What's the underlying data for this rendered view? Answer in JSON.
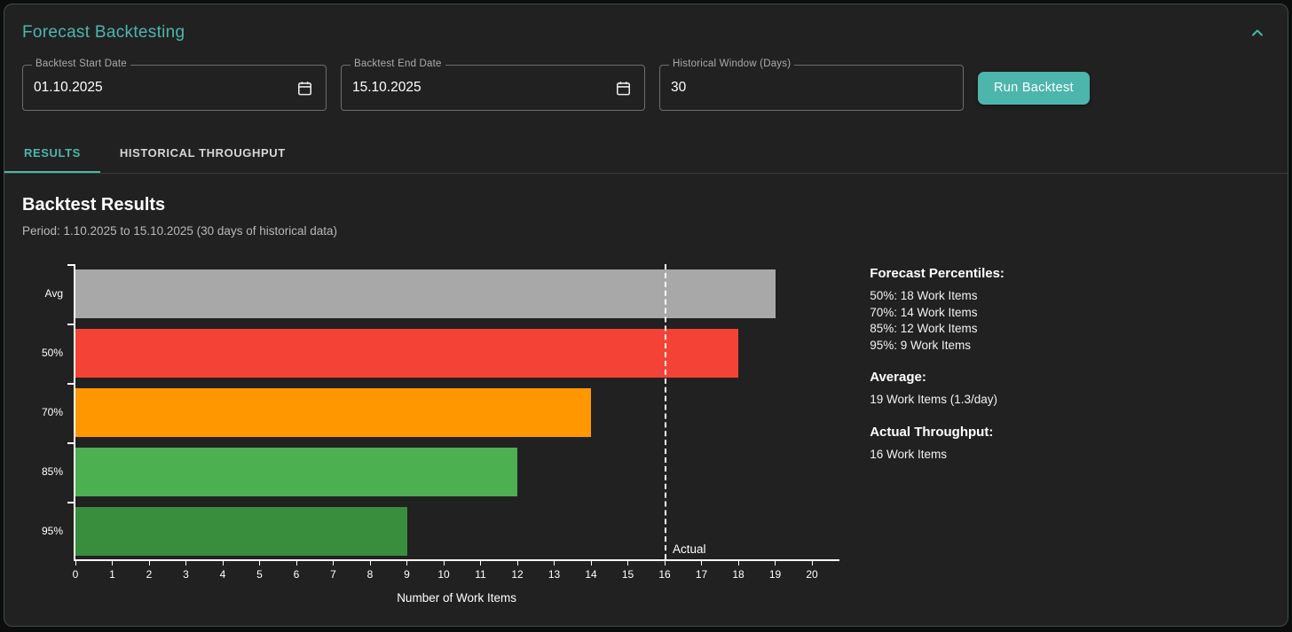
{
  "theme": {
    "accent": "#4db6ac",
    "card_background": "#212121",
    "border": "#3a4f49"
  },
  "header": {
    "title": "Forecast Backtesting"
  },
  "form": {
    "fields": [
      {
        "label": "Backtest Start Date",
        "value": "01.10.2025",
        "icon": "calendar-icon"
      },
      {
        "label": "Backtest End Date",
        "value": "15.10.2025",
        "icon": "calendar-icon"
      },
      {
        "label": "Historical Window (Days)",
        "value": "30"
      }
    ],
    "run_button": "Run Backtest"
  },
  "tabs": [
    {
      "label": "RESULTS",
      "active": true
    },
    {
      "label": "HISTORICAL THROUGHPUT",
      "active": false
    }
  ],
  "results": {
    "title": "Backtest Results",
    "period": "Period: 1.10.2025 to 15.10.2025 (30 days of historical data)"
  },
  "chart_data": {
    "type": "bar",
    "orientation": "horizontal",
    "categories": [
      "Avg",
      "50%",
      "70%",
      "85%",
      "95%"
    ],
    "values": [
      19,
      18,
      14,
      12,
      9
    ],
    "colors": [
      "#a8a8a8",
      "#f44336",
      "#ff9800",
      "#4caf50",
      "#388e3c"
    ],
    "title": "Backtest Results",
    "xlabel": "Number of Work Items",
    "ylabel": "",
    "xlim": [
      0,
      20
    ],
    "tick_step": 1,
    "grid": false,
    "legend": false,
    "actual_line": {
      "value": 16,
      "label": "Actual",
      "style": "dashed-white"
    }
  },
  "summary": {
    "percentiles_title": "Forecast Percentiles:",
    "percentiles": [
      "50%: 18 Work Items",
      "70%: 14 Work Items",
      "85%: 12 Work Items",
      "95%: 9 Work Items"
    ],
    "average_title": "Average:",
    "average_value": "19 Work Items (1.3/day)",
    "actual_title": "Actual Throughput:",
    "actual_value": "16 Work Items"
  }
}
